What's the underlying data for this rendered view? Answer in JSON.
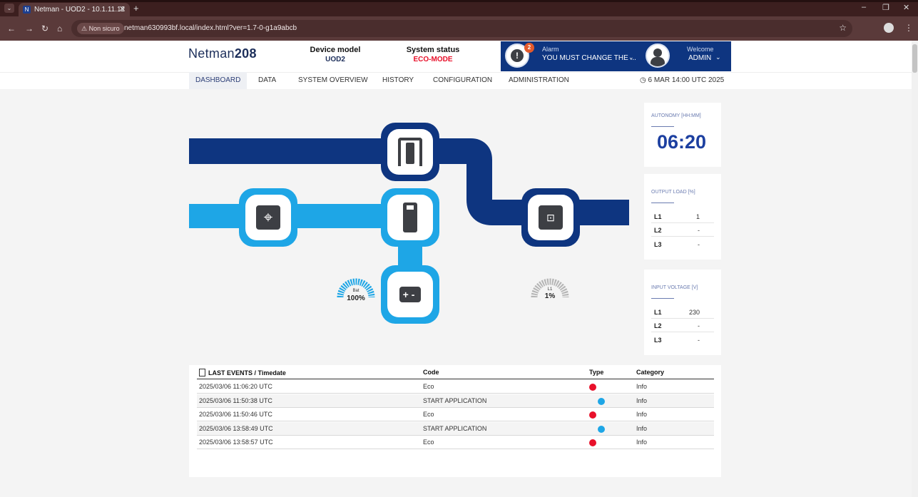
{
  "browser": {
    "tab_title": "Netman - UOD2 - 10.1.11.12",
    "tab_favicon": "N",
    "security_label": "Non sicuro",
    "url": "netman630993bf.local/index.html?ver=1.7-0-g1a9abcb"
  },
  "header": {
    "logo_text": "Netman",
    "logo_bold": "208",
    "device_model_label": "Device model",
    "device_model_value": "UOD2",
    "system_status_label": "System status",
    "system_status_value": "ECO-MODE",
    "system_status_color": "#e8102a",
    "alarm": {
      "count": "2",
      "label": "Alarm",
      "message": "YOU MUST CHANGE THE ..."
    },
    "user": {
      "welcome_label": "Welcome",
      "name": "ADMIN"
    }
  },
  "nav": {
    "items": [
      "DASHBOARD",
      "DATA",
      "SYSTEM OVERVIEW",
      "HISTORY",
      "CONFIGURATION",
      "ADMINISTRATION"
    ],
    "active": "DASHBOARD",
    "datetime": "6 MAR 14:00 UTC 2025"
  },
  "diagram": {
    "colors": {
      "dark": "#0e3580",
      "light": "#1ea6e6",
      "icon": "#3d3f44"
    },
    "battery_gauge": {
      "label": "Bat",
      "value": "100%",
      "fraction": 1.0
    },
    "load_gauge": {
      "label": "L1",
      "value": "1%",
      "fraction": 0.01
    }
  },
  "cards": {
    "autonomy": {
      "title": "AUTONOMY [HH:MM]",
      "value": "06:20"
    },
    "output_load": {
      "title": "OUTPUT LOAD [%]",
      "rows": [
        {
          "l": "L1",
          "v": "1"
        },
        {
          "l": "L2",
          "v": "-"
        },
        {
          "l": "L3",
          "v": "-"
        }
      ]
    },
    "input_voltage": {
      "title": "INPUT VOLTAGE [V]",
      "rows": [
        {
          "l": "L1",
          "v": "230"
        },
        {
          "l": "L2",
          "v": "-"
        },
        {
          "l": "L3",
          "v": "-"
        }
      ]
    }
  },
  "events": {
    "headers": {
      "time": "LAST EVENTS / Timedate",
      "code": "Code",
      "type": "Type",
      "category": "Category"
    },
    "rows": [
      {
        "time": "2025/03/06 11:06:20 UTC",
        "code": "Eco",
        "type": "red",
        "category": "Info"
      },
      {
        "time": "2025/03/06 11:50:38 UTC",
        "code": "START APPLICATION",
        "type": "blue",
        "category": "Info"
      },
      {
        "time": "2025/03/06 11:50:46 UTC",
        "code": "Eco",
        "type": "red",
        "category": "Info"
      },
      {
        "time": "2025/03/06 13:58:49 UTC",
        "code": "START APPLICATION",
        "type": "blue",
        "category": "Info"
      },
      {
        "time": "2025/03/06 13:58:57 UTC",
        "code": "Eco",
        "type": "red",
        "category": "Info"
      }
    ],
    "type_colors": {
      "red": "#e8102a",
      "blue": "#1ea6e6"
    }
  }
}
